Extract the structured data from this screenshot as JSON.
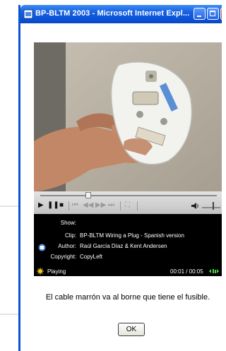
{
  "window": {
    "title": "BP-BLTM 2003 - Microsoft Internet Expl..."
  },
  "player": {
    "seek_progress": 0.27,
    "controls": [
      "play-icon",
      "pause-icon",
      "stop-icon",
      "previous-icon",
      "rewind-icon",
      "fast-forward-icon",
      "next-icon",
      "fullscreen-icon",
      "volume-icon"
    ],
    "info": {
      "show_label": "Show:",
      "show_value": "",
      "clip_label": "Clip:",
      "clip_value": "BP-BLTM Wiring a Plug - Spanish version",
      "author_label": "Author:",
      "author_value": "Raúl García Díaz & Kent Andersen",
      "copyright_label": "Copyright:",
      "copyright_value": "CopyLeft"
    },
    "status": {
      "text": "Playing",
      "time": "00:01 / 00:05"
    }
  },
  "message": "El cable marrón va al borne que tiene el fusible.",
  "ok_label": "OK",
  "colors": {
    "titlebar": "#0a4fd3",
    "player_bg": "#000000",
    "controls_bg": "#d0d0d0"
  }
}
